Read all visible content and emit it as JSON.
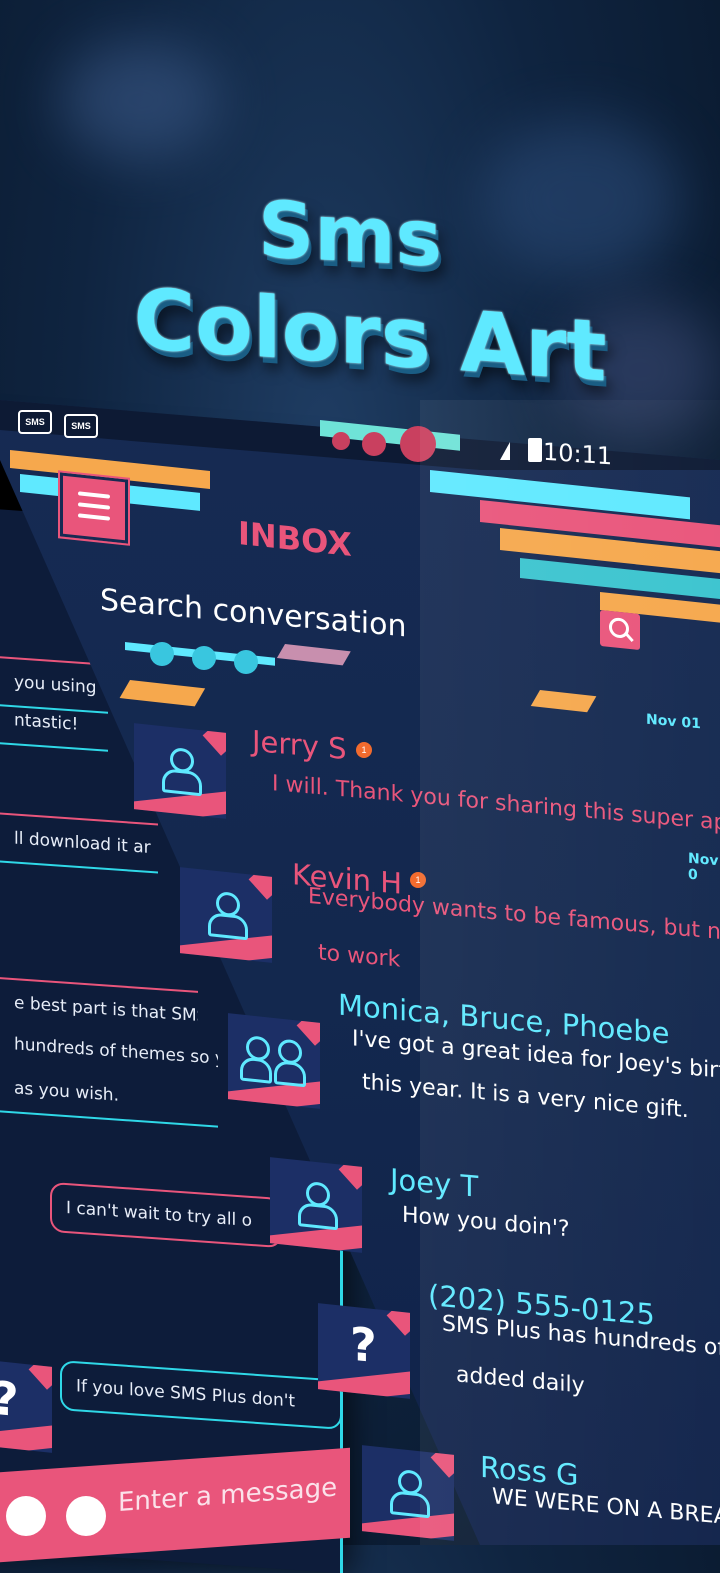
{
  "title": {
    "line1": "Sms",
    "line2": "Colors Art"
  },
  "status_bar": {
    "time": "10:11",
    "app_icons": [
      "SMS",
      "SMS"
    ]
  },
  "inbox": {
    "header": "INBOX",
    "search_placeholder": "Search conversation",
    "conversations": [
      {
        "name": "Jerry S",
        "message": "I will. Thank you for sharing this super app!",
        "date": "Nov 01",
        "unread": "1",
        "avatar": "person-icon"
      },
      {
        "name": "Kevin H",
        "message_line1": "Everybody wants to be famous, but nobody w",
        "message_line2": "to work",
        "date": "Nov 0",
        "unread": "1",
        "avatar": "person-icon"
      },
      {
        "name": "Monica, Bruce, Phoebe",
        "message_line1": "I've got a great idea for Joey's birthday p",
        "message_line2": "this year. It is a very nice gift.",
        "avatar": "group-icon"
      },
      {
        "name": "Joey T",
        "message": "How you doin'?",
        "avatar": "person-icon"
      },
      {
        "name": "(202) 555-0125",
        "message_line1": "SMS Plus has hundreds of free",
        "message_line2": "added daily",
        "avatar": "unknown-icon"
      },
      {
        "name": "Ross G",
        "message": "WE WERE ON A BREAK!!",
        "avatar": "person-icon"
      }
    ]
  },
  "conversation": {
    "messages": [
      {
        "text": "you using",
        "type": "recv"
      },
      {
        "text": "ntastic!",
        "type": "recv"
      },
      {
        "text": "ll download it ar",
        "type": "recv"
      },
      {
        "text": "e best part is that SMS",
        "type": "recv"
      },
      {
        "text": "hundreds of themes so yo",
        "type": "recv"
      },
      {
        "text": "as you wish.",
        "type": "recv"
      },
      {
        "text": "I can't wait to try all o",
        "type": "sent"
      },
      {
        "text": "If you love SMS Plus don't",
        "type": "sent"
      }
    ],
    "input_placeholder": "Enter a message"
  },
  "colors": {
    "accent_pink": "#e9557b",
    "accent_cyan": "#5fe9ff",
    "accent_orange": "#f6a84d",
    "background": "#13284e"
  }
}
